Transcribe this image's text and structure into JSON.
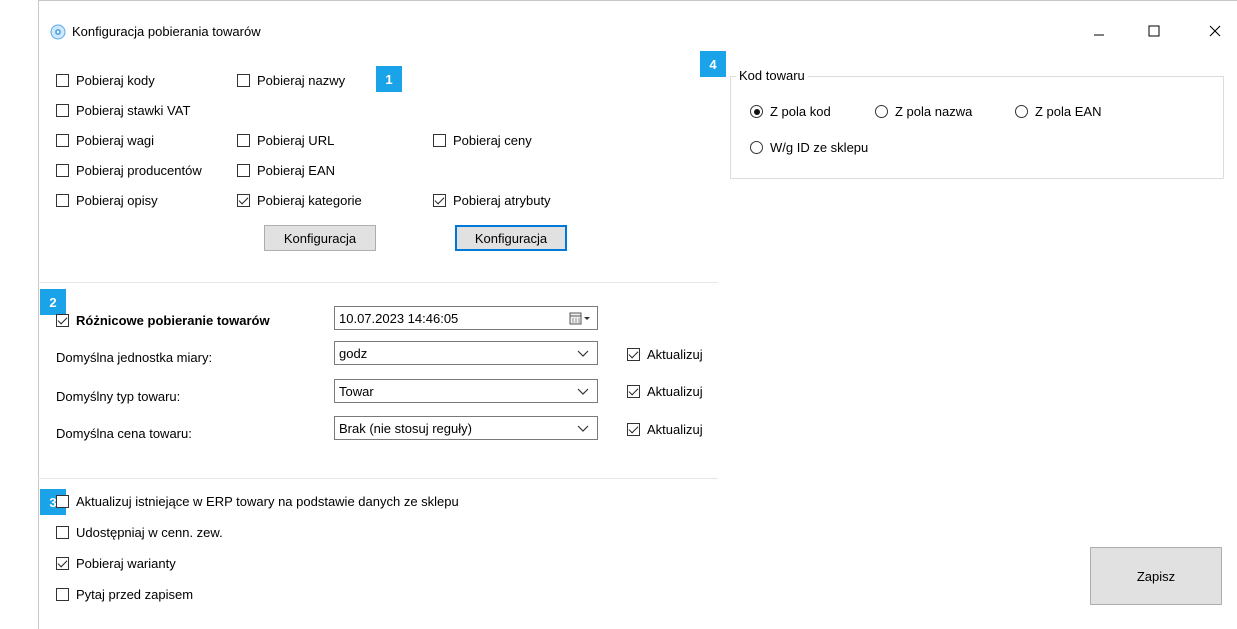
{
  "window": {
    "title": "Konfiguracja pobierania towarów",
    "minimize_glyph": "—",
    "maximize_glyph": "☐",
    "close_glyph": "✕"
  },
  "badges": [
    "1",
    "2",
    "3",
    "4"
  ],
  "section1": {
    "checkboxes": [
      {
        "label": "Pobieraj kody",
        "checked": false
      },
      {
        "label": "Pobieraj nazwy",
        "checked": false
      },
      {
        "label": "Pobieraj stawki VAT",
        "checked": false
      },
      {
        "label": "Pobieraj wagi",
        "checked": false
      },
      {
        "label": "Pobieraj URL",
        "checked": false
      },
      {
        "label": "Pobieraj ceny",
        "checked": false
      },
      {
        "label": "Pobieraj producentów",
        "checked": false
      },
      {
        "label": "Pobieraj EAN",
        "checked": false
      },
      {
        "label": "Pobieraj opisy",
        "checked": false
      },
      {
        "label": "Pobieraj kategorie",
        "checked": true
      },
      {
        "label": "Pobieraj atrybuty",
        "checked": true
      }
    ],
    "config_button_1": "Konfiguracja",
    "config_button_2": "Konfiguracja"
  },
  "section2": {
    "diff_label": "Różnicowe pobieranie towarów",
    "diff_checked": true,
    "datetime_value": "10.07.2023 14:46:05",
    "rows": [
      {
        "label": "Domyślna jednostka miary:",
        "value": "godz",
        "update_label": "Aktualizuj",
        "update_checked": true
      },
      {
        "label": "Domyślny typ towaru:",
        "value": "Towar",
        "update_label": "Aktualizuj",
        "update_checked": true
      },
      {
        "label": "Domyślna cena towaru:",
        "value": "Brak (nie stosuj reguły)",
        "update_label": "Aktualizuj",
        "update_checked": true
      }
    ]
  },
  "section3": {
    "checkboxes": [
      {
        "label": "Aktualizuj istniejące w ERP towary na podstawie danych ze sklepu",
        "checked": false
      },
      {
        "label": "Udostępniaj w cenn. zew.",
        "checked": false
      },
      {
        "label": "Pobieraj warianty",
        "checked": true
      },
      {
        "label": "Pytaj przed zapisem",
        "checked": false
      }
    ]
  },
  "section4": {
    "group_title": "Kod towaru",
    "radios": [
      {
        "label": "Z pola kod",
        "checked": true
      },
      {
        "label": "Z pola nazwa",
        "checked": false
      },
      {
        "label": "Z pola EAN",
        "checked": false
      },
      {
        "label": "W/g ID ze sklepu",
        "checked": false
      }
    ]
  },
  "save_button": "Zapisz",
  "colors": {
    "badge": "#1aa3e8",
    "focus": "#0078d7",
    "button": "#e1e1e1"
  }
}
